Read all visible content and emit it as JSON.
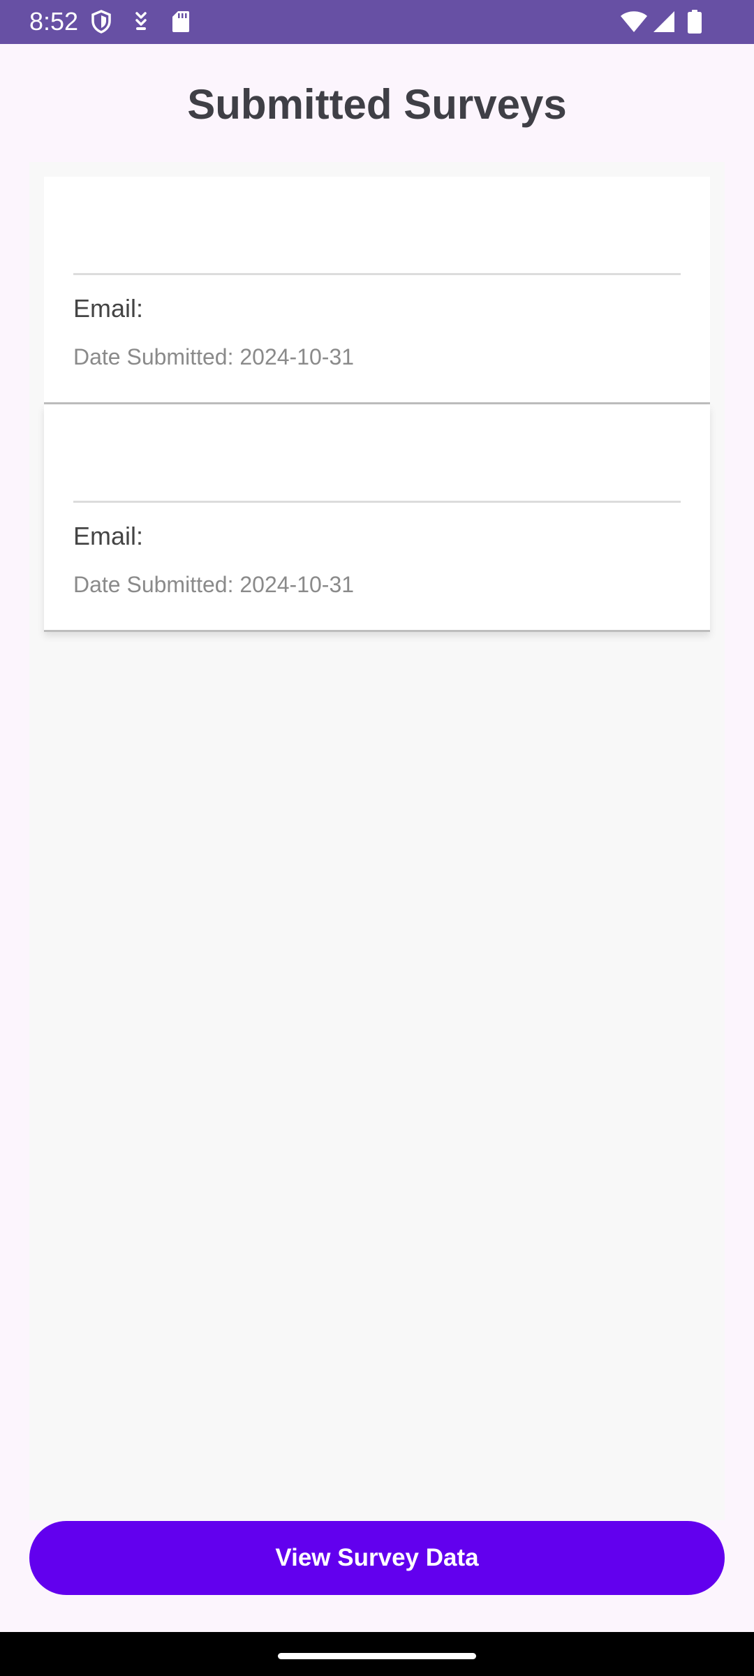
{
  "status_bar": {
    "time": "8:52",
    "left_icons": [
      "shield-icon",
      "download-icon",
      "sd-card-icon"
    ],
    "right_icons": [
      "wifi-icon",
      "signal-icon",
      "battery-icon"
    ],
    "background_color": "#6750a4"
  },
  "page": {
    "title": "Submitted Surveys"
  },
  "surveys": [
    {
      "name": "",
      "email_label": "Email:",
      "date_label": "Date Submitted: 2024-10-31"
    },
    {
      "name": "",
      "email_label": "Email:",
      "date_label": "Date Submitted: 2024-10-31"
    }
  ],
  "actions": {
    "view_button_label": "View Survey Data",
    "button_color": "#6200ee"
  }
}
